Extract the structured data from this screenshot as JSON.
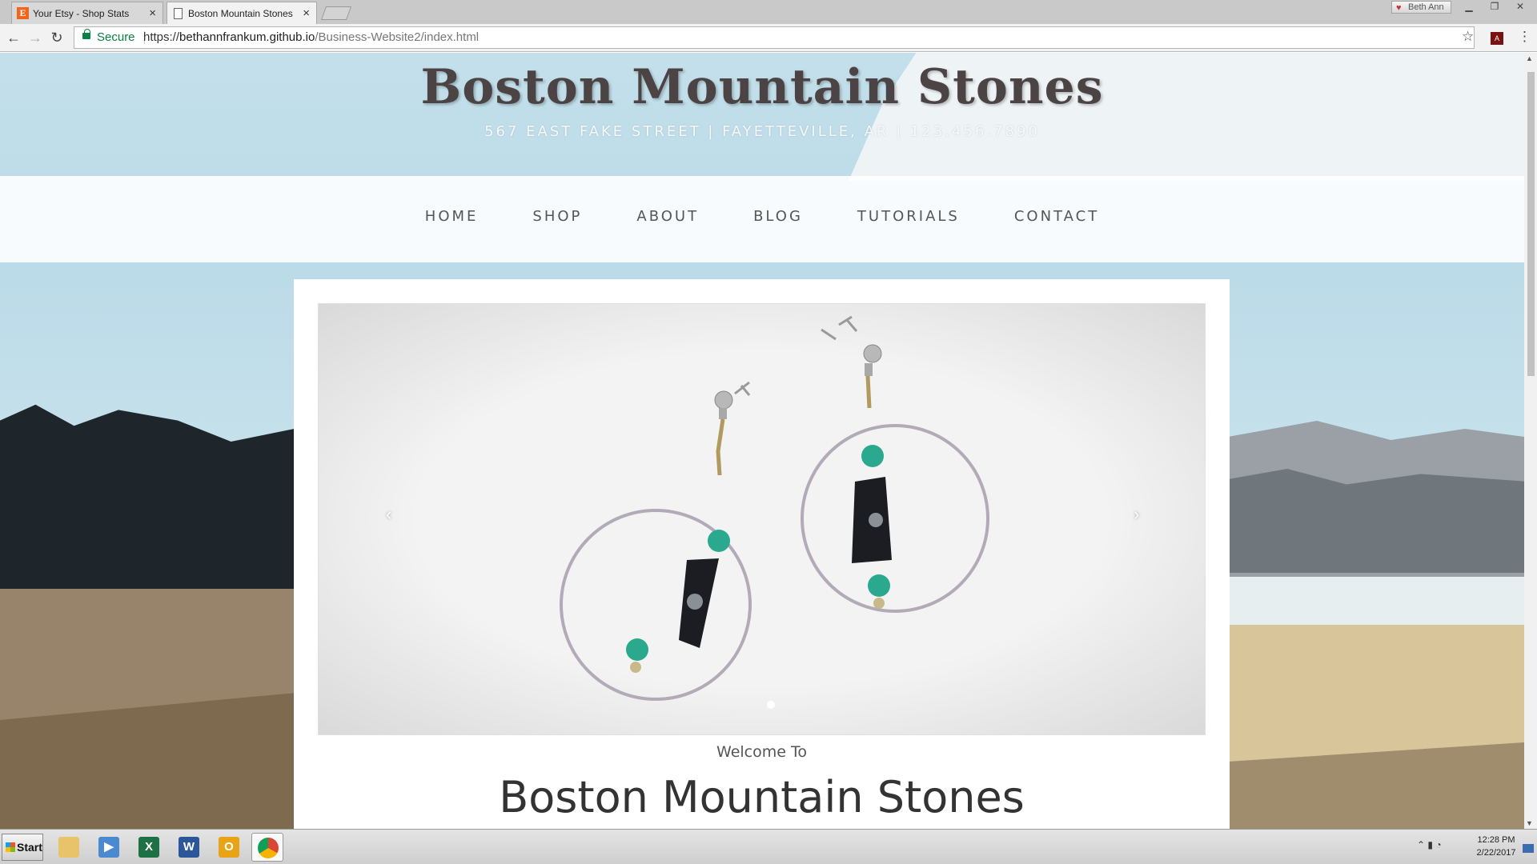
{
  "browser": {
    "tabs": [
      {
        "title": "Your Etsy - Shop Stats",
        "favicon": "E"
      },
      {
        "title": "Boston Mountain Stones"
      }
    ],
    "profile_name": "Beth Ann",
    "secure_label": "Secure",
    "url_scheme": "https://",
    "url_domain": "bethannfrankum.github.io",
    "url_path": "/Business-Website2/index.html"
  },
  "site": {
    "title": "Boston Mountain Stones",
    "address": "567 East Fake Street | Fayetteville, AR | 123.456.7890",
    "nav": [
      "HOME",
      "SHOP",
      "ABOUT",
      "BLOG",
      "TUTORIALS",
      "CONTACT"
    ],
    "carousel_prev": "‹",
    "carousel_next": "›",
    "welcome": "Welcome To",
    "heading": "Boston Mountain Stones"
  },
  "taskbar": {
    "start_label": "Start",
    "time": "12:28 PM",
    "date": "2/22/2017"
  },
  "colors": {
    "title": "#4c4444",
    "nav_text": "#555555",
    "turquoise": "#2aa98f"
  }
}
